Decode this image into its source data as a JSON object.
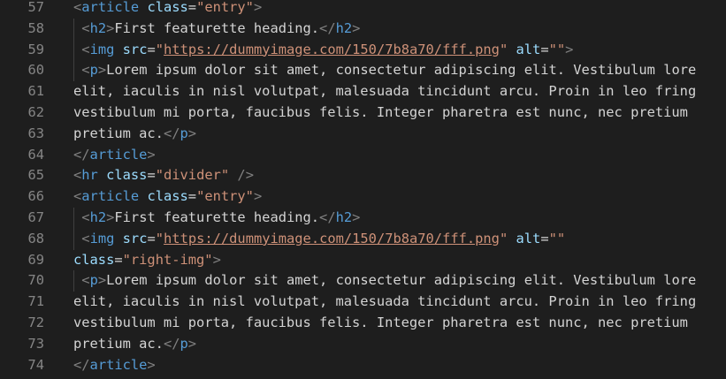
{
  "editor": {
    "lines": [
      {
        "num": "57",
        "tokens": [
          {
            "t": "punc",
            "v": "<"
          },
          {
            "t": "tag",
            "v": "article"
          },
          {
            "t": "txt",
            "v": " "
          },
          {
            "t": "attr",
            "v": "class"
          },
          {
            "t": "txt",
            "v": "="
          },
          {
            "t": "str",
            "v": "\"entry\""
          },
          {
            "t": "punc",
            "v": ">"
          }
        ]
      },
      {
        "num": "58",
        "guide": true,
        "tokens": [
          {
            "t": "txt",
            "v": " "
          },
          {
            "t": "punc",
            "v": "<"
          },
          {
            "t": "tag",
            "v": "h2"
          },
          {
            "t": "punc",
            "v": ">"
          },
          {
            "t": "txt",
            "v": "First featurette heading."
          },
          {
            "t": "punc",
            "v": "</"
          },
          {
            "t": "tag",
            "v": "h2"
          },
          {
            "t": "punc",
            "v": ">"
          }
        ]
      },
      {
        "num": "59",
        "guide": true,
        "tokens": [
          {
            "t": "txt",
            "v": " "
          },
          {
            "t": "punc",
            "v": "<"
          },
          {
            "t": "tag",
            "v": "img"
          },
          {
            "t": "txt",
            "v": " "
          },
          {
            "t": "attr",
            "v": "src"
          },
          {
            "t": "txt",
            "v": "="
          },
          {
            "t": "str",
            "v": "\""
          },
          {
            "t": "url",
            "v": "https://dummyimage.com/150/7b8a70/fff.png"
          },
          {
            "t": "str",
            "v": "\""
          },
          {
            "t": "txt",
            "v": " "
          },
          {
            "t": "attr",
            "v": "alt"
          },
          {
            "t": "txt",
            "v": "="
          },
          {
            "t": "str",
            "v": "\"\""
          },
          {
            "t": "punc",
            "v": ">"
          }
        ]
      },
      {
        "num": "60",
        "guide": true,
        "tokens": [
          {
            "t": "txt",
            "v": " "
          },
          {
            "t": "punc",
            "v": "<"
          },
          {
            "t": "tag",
            "v": "p"
          },
          {
            "t": "punc",
            "v": ">"
          },
          {
            "t": "txt",
            "v": "Lorem ipsum dolor sit amet, consectetur adipiscing elit. Vestibulum lore"
          }
        ]
      },
      {
        "num": "61",
        "tokens": [
          {
            "t": "txt",
            "v": "elit, iaculis in nisl volutpat, malesuada tincidunt arcu. Proin in leo fring"
          }
        ]
      },
      {
        "num": "62",
        "tokens": [
          {
            "t": "txt",
            "v": "vestibulum mi porta, faucibus felis. Integer pharetra est nunc, nec pretium"
          }
        ]
      },
      {
        "num": "63",
        "tokens": [
          {
            "t": "txt",
            "v": "pretium ac."
          },
          {
            "t": "punc",
            "v": "</"
          },
          {
            "t": "tag",
            "v": "p"
          },
          {
            "t": "punc",
            "v": ">"
          }
        ]
      },
      {
        "num": "64",
        "tokens": [
          {
            "t": "punc",
            "v": "</"
          },
          {
            "t": "tag",
            "v": "article"
          },
          {
            "t": "punc",
            "v": ">"
          }
        ]
      },
      {
        "num": "65",
        "tokens": [
          {
            "t": "punc",
            "v": "<"
          },
          {
            "t": "tag",
            "v": "hr"
          },
          {
            "t": "txt",
            "v": " "
          },
          {
            "t": "attr",
            "v": "class"
          },
          {
            "t": "txt",
            "v": "="
          },
          {
            "t": "str",
            "v": "\"divider\""
          },
          {
            "t": "txt",
            "v": " "
          },
          {
            "t": "punc",
            "v": "/>"
          }
        ]
      },
      {
        "num": "66",
        "tokens": [
          {
            "t": "punc",
            "v": "<"
          },
          {
            "t": "tag",
            "v": "article"
          },
          {
            "t": "txt",
            "v": " "
          },
          {
            "t": "attr",
            "v": "class"
          },
          {
            "t": "txt",
            "v": "="
          },
          {
            "t": "str",
            "v": "\"entry\""
          },
          {
            "t": "punc",
            "v": ">"
          }
        ]
      },
      {
        "num": "67",
        "guide": true,
        "tokens": [
          {
            "t": "txt",
            "v": " "
          },
          {
            "t": "punc",
            "v": "<"
          },
          {
            "t": "tag",
            "v": "h2"
          },
          {
            "t": "punc",
            "v": ">"
          },
          {
            "t": "txt",
            "v": "First featurette heading."
          },
          {
            "t": "punc",
            "v": "</"
          },
          {
            "t": "tag",
            "v": "h2"
          },
          {
            "t": "punc",
            "v": ">"
          }
        ]
      },
      {
        "num": "68",
        "guide": true,
        "tokens": [
          {
            "t": "txt",
            "v": " "
          },
          {
            "t": "punc",
            "v": "<"
          },
          {
            "t": "tag",
            "v": "img"
          },
          {
            "t": "txt",
            "v": " "
          },
          {
            "t": "attr",
            "v": "src"
          },
          {
            "t": "txt",
            "v": "="
          },
          {
            "t": "str",
            "v": "\""
          },
          {
            "t": "url",
            "v": "https://dummyimage.com/150/7b8a70/fff.png"
          },
          {
            "t": "str",
            "v": "\""
          },
          {
            "t": "txt",
            "v": " "
          },
          {
            "t": "attr",
            "v": "alt"
          },
          {
            "t": "txt",
            "v": "="
          },
          {
            "t": "str",
            "v": "\"\""
          }
        ]
      },
      {
        "num": "69",
        "tokens": [
          {
            "t": "attr",
            "v": "class"
          },
          {
            "t": "txt",
            "v": "="
          },
          {
            "t": "str",
            "v": "\"right-img\""
          },
          {
            "t": "punc",
            "v": ">"
          }
        ]
      },
      {
        "num": "70",
        "guide": true,
        "tokens": [
          {
            "t": "txt",
            "v": " "
          },
          {
            "t": "punc",
            "v": "<"
          },
          {
            "t": "tag",
            "v": "p"
          },
          {
            "t": "punc",
            "v": ">"
          },
          {
            "t": "txt",
            "v": "Lorem ipsum dolor sit amet, consectetur adipiscing elit. Vestibulum lore"
          }
        ]
      },
      {
        "num": "71",
        "tokens": [
          {
            "t": "txt",
            "v": "elit, iaculis in nisl volutpat, malesuada tincidunt arcu. Proin in leo fring"
          }
        ]
      },
      {
        "num": "72",
        "tokens": [
          {
            "t": "txt",
            "v": "vestibulum mi porta, faucibus felis. Integer pharetra est nunc, nec pretium"
          }
        ]
      },
      {
        "num": "73",
        "tokens": [
          {
            "t": "txt",
            "v": "pretium ac."
          },
          {
            "t": "punc",
            "v": "</"
          },
          {
            "t": "tag",
            "v": "p"
          },
          {
            "t": "punc",
            "v": ">"
          }
        ]
      },
      {
        "num": "74",
        "tokens": [
          {
            "t": "punc",
            "v": "</"
          },
          {
            "t": "tag",
            "v": "article"
          },
          {
            "t": "punc",
            "v": ">"
          }
        ]
      }
    ]
  },
  "colors": {
    "background": "#1e1e1e",
    "line_number": "#858585",
    "tag": "#569cd6",
    "attribute": "#9cdcfe",
    "string": "#ce9178",
    "text": "#d4d4d4",
    "punctuation": "#808080"
  }
}
